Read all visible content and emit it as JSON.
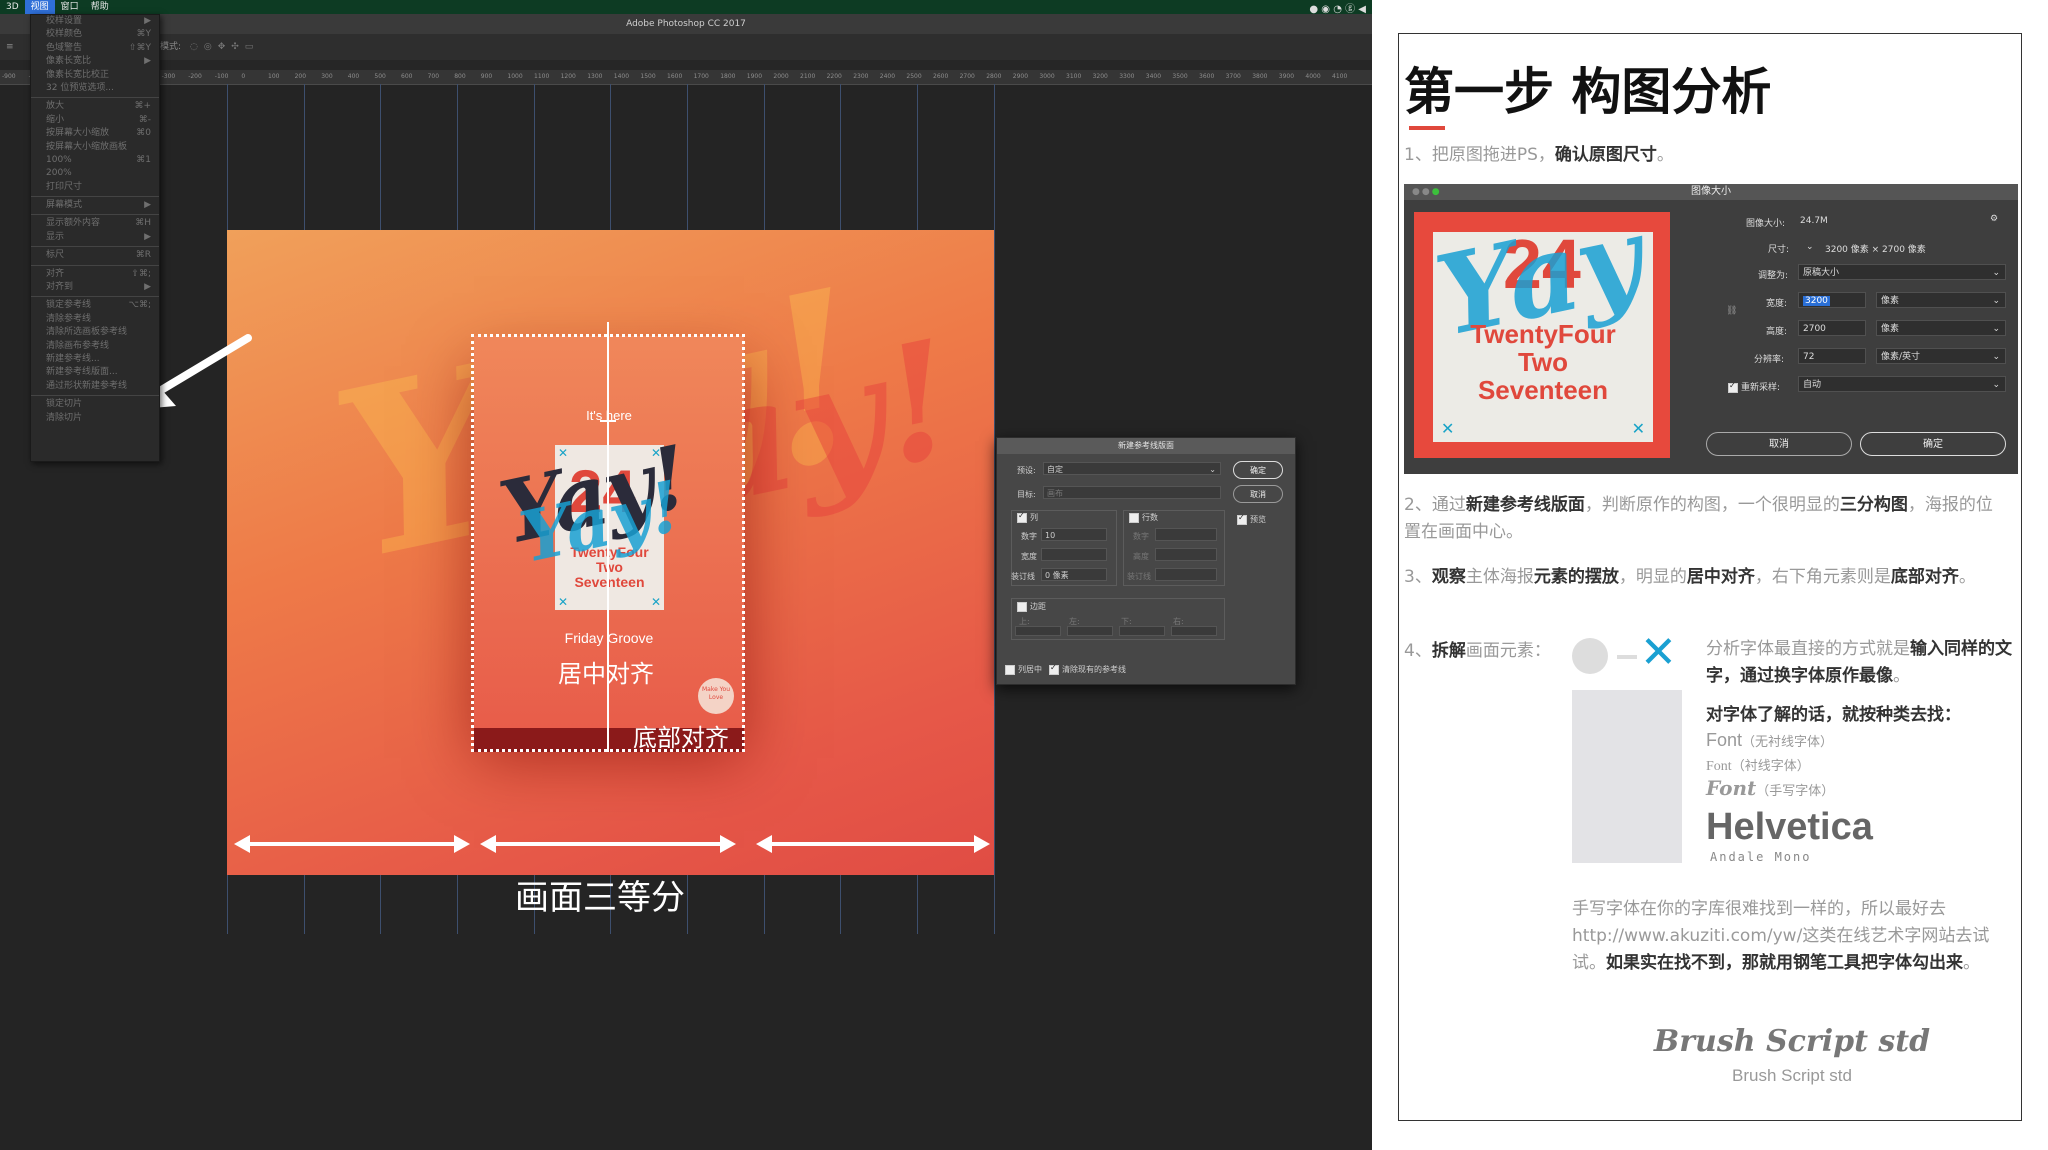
{
  "menubar": {
    "items": [
      "3D",
      "视图",
      "窗口",
      "帮助"
    ],
    "active_index": 1
  },
  "window_title": "Adobe Photoshop CC 2017",
  "options_bar_label": "模式:",
  "view_menu": {
    "items": [
      {
        "label": "校样设置",
        "shortcut": "▶"
      },
      {
        "label": "校样颜色",
        "shortcut": "⌘Y"
      },
      {
        "label": "色域警告",
        "shortcut": "⇧⌘Y"
      },
      {
        "label": "像素长宽比",
        "shortcut": "▶"
      },
      {
        "label": "像素长宽比校正",
        "shortcut": ""
      },
      {
        "label": "32 位预览选项...",
        "shortcut": ""
      },
      {
        "sep": true
      },
      {
        "label": "放大",
        "shortcut": "⌘+"
      },
      {
        "label": "缩小",
        "shortcut": "⌘-"
      },
      {
        "label": "按屏幕大小缩放",
        "shortcut": "⌘0"
      },
      {
        "label": "按屏幕大小缩放画板",
        "shortcut": ""
      },
      {
        "label": "100%",
        "shortcut": "⌘1"
      },
      {
        "label": "200%",
        "shortcut": ""
      },
      {
        "label": "打印尺寸",
        "shortcut": ""
      },
      {
        "sep": true
      },
      {
        "label": "屏幕模式",
        "shortcut": "▶"
      },
      {
        "sep": true
      },
      {
        "label": "显示额外内容",
        "shortcut": "⌘H"
      },
      {
        "label": "显示",
        "shortcut": "▶"
      },
      {
        "sep": true
      },
      {
        "label": "标尺",
        "shortcut": "⌘R"
      },
      {
        "sep": true
      },
      {
        "label": "对齐",
        "shortcut": "⇧⌘;"
      },
      {
        "label": "对齐到",
        "shortcut": "▶"
      },
      {
        "sep": true
      },
      {
        "label": "锁定参考线",
        "shortcut": "⌥⌘;"
      },
      {
        "label": "清除参考线",
        "shortcut": ""
      },
      {
        "label": "清除所选画板参考线",
        "shortcut": ""
      },
      {
        "label": "清除画布参考线",
        "shortcut": ""
      },
      {
        "label": "新建参考线...",
        "shortcut": ""
      },
      {
        "label": "新建参考线版面...",
        "shortcut": ""
      },
      {
        "label": "通过形状新建参考线",
        "shortcut": ""
      },
      {
        "sep": true
      },
      {
        "label": "锁定切片",
        "shortcut": ""
      },
      {
        "label": "清除切片",
        "shortcut": ""
      }
    ]
  },
  "ruler_ticks": [
    "-900",
    "-800",
    "-700",
    "-600",
    "-500",
    "-400",
    "-300",
    "-200",
    "-100",
    "0",
    "100",
    "200",
    "300",
    "400",
    "500",
    "600",
    "700",
    "800",
    "900",
    "1000",
    "1100",
    "1200",
    "1300",
    "1400",
    "1500",
    "1600",
    "1700",
    "1800",
    "1900",
    "2000",
    "2100",
    "2200",
    "2300",
    "2400",
    "2500",
    "2600",
    "2700",
    "2800",
    "2900",
    "3000",
    "3100",
    "3200",
    "3300",
    "3400",
    "3500",
    "3600",
    "3700",
    "3800",
    "3900",
    "4000",
    "4100"
  ],
  "poster": {
    "its_here": "It's here",
    "number": "24",
    "line1": "TwentyFour",
    "line2": "Two",
    "line3": "Seventeen",
    "friday": "Friday Groove",
    "badge": "Make You Love",
    "script": "Yay!",
    "bg_script": "Yay!"
  },
  "annotations": {
    "center_align": "居中对齐",
    "bottom_align": "底部对齐",
    "thirds": "画面三等分"
  },
  "guide_dialog": {
    "title": "新建参考线版面",
    "preset_label": "预设:",
    "preset_value": "自定",
    "target_label": "目标:",
    "target_value": "画布",
    "ok": "确定",
    "cancel": "取消",
    "preview": "预览",
    "columns_label": "列",
    "rows_label": "行数",
    "number_label": "数字",
    "number_value": "10",
    "width_label": "宽度",
    "gutter_label": "装订线",
    "gutter_value": "0 像素",
    "rows_number_label": "数字",
    "rows_height_label": "高度",
    "rows_gutter_label": "装订线",
    "margin_label": "边距",
    "margin_top": "上:",
    "margin_left": "左:",
    "margin_bottom": "下:",
    "margin_right": "右:",
    "center_cols": "列居中",
    "clear_existing": "清除现有的参考线"
  },
  "panel": {
    "title": "第一步 构图分析",
    "step1_a": "1、把原图拖进PS，",
    "step1_b": "确认原图尺寸",
    "step1_c": "。",
    "step2_a": "2、通过",
    "step2_b": "新建参考线版面",
    "step2_c": "，判断原作的构图，一个很明显的",
    "step2_d": "三分构图",
    "step2_e": "，海报的位置在画面中心。",
    "step3_a": "3、",
    "step3_b": "观察",
    "step3_c": "主体海报",
    "step3_d": "元素的摆放",
    "step3_e": "，明显的",
    "step3_f": "居中对齐",
    "step3_g": "，右下角元素则是",
    "step3_h": "底部对齐",
    "step3_i": "。",
    "step4_a": "4、",
    "step4_b": "拆解",
    "step4_c": "画面元素：",
    "analysis_a": "分析字体最直接的方式就是",
    "analysis_b": "输入同样的文字，通过换字体原作最像",
    "analysis_c": "。",
    "fonts_intro": "对字体了解的话，就按种类去找：",
    "font_sans": "Font",
    "font_sans_note": "（无衬线字体）",
    "font_serif": "Font",
    "font_serif_note": "（衬线字体）",
    "font_script": "Font",
    "font_script_note": "（手写字体）",
    "helvetica": "Helvetica",
    "andale": "Andale Mono",
    "handwrite_a": "手写字体在你的字库很难找到一样的，所以最好去http://www.akuziti.com/yw/这类在线艺术字网站去试试。",
    "handwrite_b": "如果实在找不到，那就用钢笔工具把字体勾出来",
    "handwrite_c": "。",
    "brush_script": "Brush Script std",
    "brush_script_plain": "Brush Script std"
  },
  "image_size_dialog": {
    "title": "图像大小",
    "size_label": "图像大小:",
    "size_value": "24.7M",
    "dims_label": "尺寸:",
    "dims_value": "3200 像素 × 2700 像素",
    "fit_label": "调整为:",
    "fit_value": "原稿大小",
    "width_label": "宽度:",
    "width_value": "3200",
    "width_unit": "像素",
    "height_label": "高度:",
    "height_value": "2700",
    "height_unit": "像素",
    "res_label": "分辨率:",
    "res_value": "72",
    "res_unit": "像素/英寸",
    "resample_label": "重新采样:",
    "resample_value": "自动",
    "cancel": "取消",
    "ok": "确定",
    "thumb_line1": "TwentyFour",
    "thumb_line2": "Two",
    "thumb_line3": "Seventeen",
    "thumb_number": "24",
    "thumb_script": "Yay"
  }
}
